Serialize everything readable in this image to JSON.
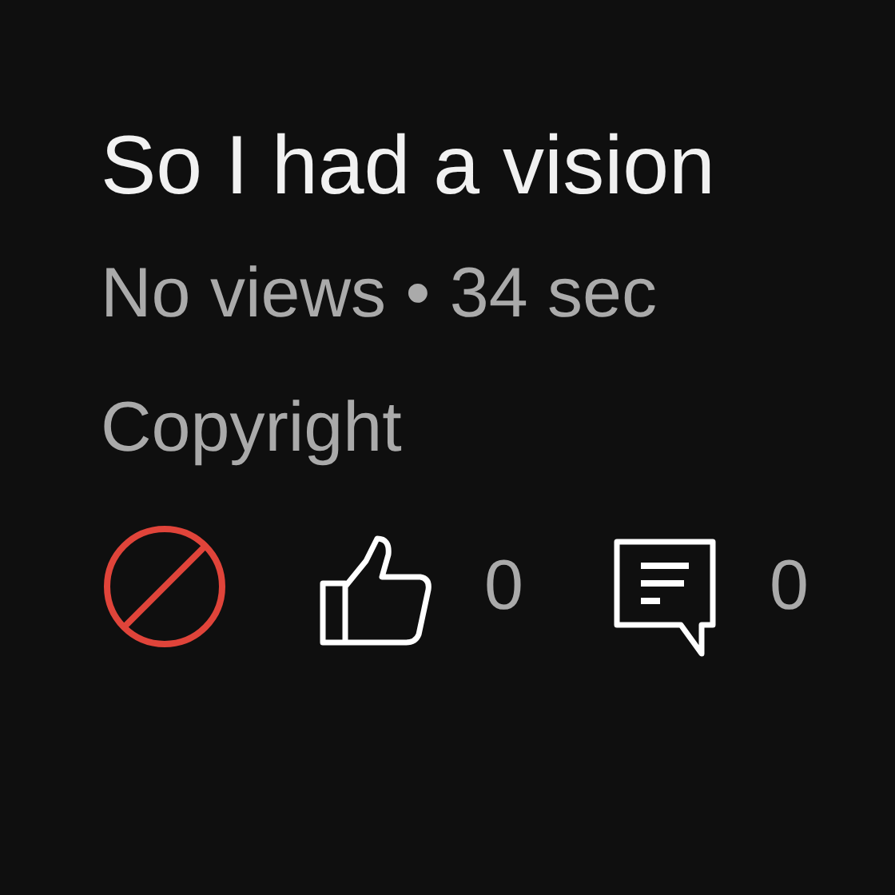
{
  "title": "So I had a vision",
  "meta": "No views • 34 sec",
  "license": "Copyright",
  "actions": [
    {
      "kind": "blocked"
    },
    {
      "kind": "like",
      "count": "0"
    },
    {
      "kind": "comment",
      "count": "0"
    }
  ]
}
